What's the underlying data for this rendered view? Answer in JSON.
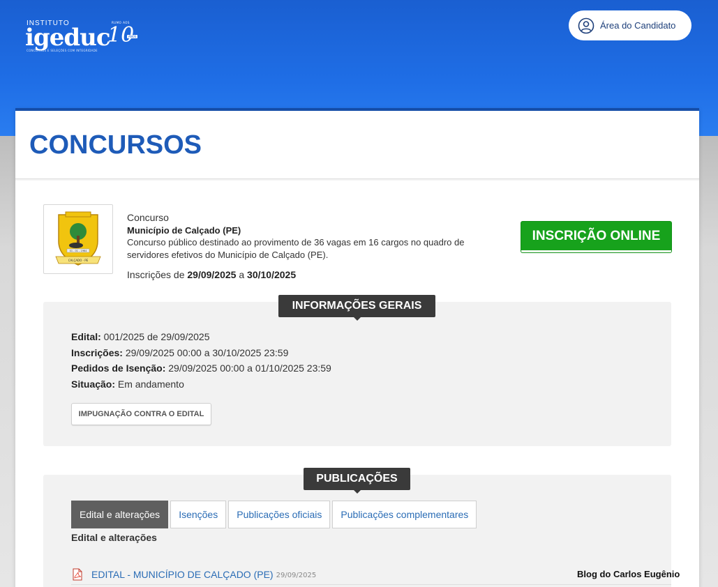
{
  "colors": {
    "brand_blue": "#1f6ee6",
    "accent_green": "#17a21c",
    "link_blue": "#2a6cb5",
    "tag_dark": "#3a3a3a"
  },
  "header": {
    "logo": {
      "small_text": "INSTITUTO",
      "word": "igeduc",
      "tagline": "CONCURSOS E SELEÇÕES COM INTEGRIDADE",
      "ten": "10",
      "badge_top": "RUMO AOS",
      "badge_right": "ANOS"
    },
    "candidate_button": {
      "label": "Área do Candidato",
      "icon": "user-circle-icon"
    }
  },
  "page": {
    "title": "CONCURSOS"
  },
  "contest": {
    "crest_label": "CALÇADO - PE",
    "crest_date": "01 - 01 - 1964",
    "type_label": "Concurso",
    "name": "Município de Calçado (PE)",
    "description": "Concurso público destinado ao provimento de 36 vagas em 16 cargos no quadro de servidores efetivos do Município de Calçado (PE).",
    "dates_prefix": "Inscrições de",
    "date_start": "29/09/2025",
    "dates_joiner": "a",
    "date_end": "30/10/2025",
    "cta_label": "INSCRIÇÃO ONLINE"
  },
  "general_info": {
    "tag": "INFORMAÇÕES GERAIS",
    "rows": [
      {
        "label": "Edital:",
        "value": "001/2025 de 29/09/2025"
      },
      {
        "label": "Inscrições:",
        "value": "29/09/2025 00:00 a 30/10/2025 23:59"
      },
      {
        "label": "Pedidos de Isenção:",
        "value": "29/09/2025 00:00 a 01/10/2025 23:59"
      },
      {
        "label": "Situação:",
        "value": "Em andamento"
      }
    ],
    "impugnacao_button": "IMPUGNAÇÃO CONTRA O EDITAL"
  },
  "publications": {
    "tag": "PUBLICAÇÕES",
    "tabs": [
      {
        "label": "Edital e alterações",
        "active": true
      },
      {
        "label": "Isenções",
        "active": false
      },
      {
        "label": "Publicações oficiais",
        "active": false
      },
      {
        "label": "Publicações complementares",
        "active": false
      }
    ],
    "active_heading": "Edital e alterações",
    "items": [
      {
        "icon": "pdf-icon",
        "title": "EDITAL - MUNICÍPIO DE CALÇADO (PE)",
        "date": "29/09/2025"
      }
    ]
  },
  "watermark": "Blog do Carlos Eugênio"
}
